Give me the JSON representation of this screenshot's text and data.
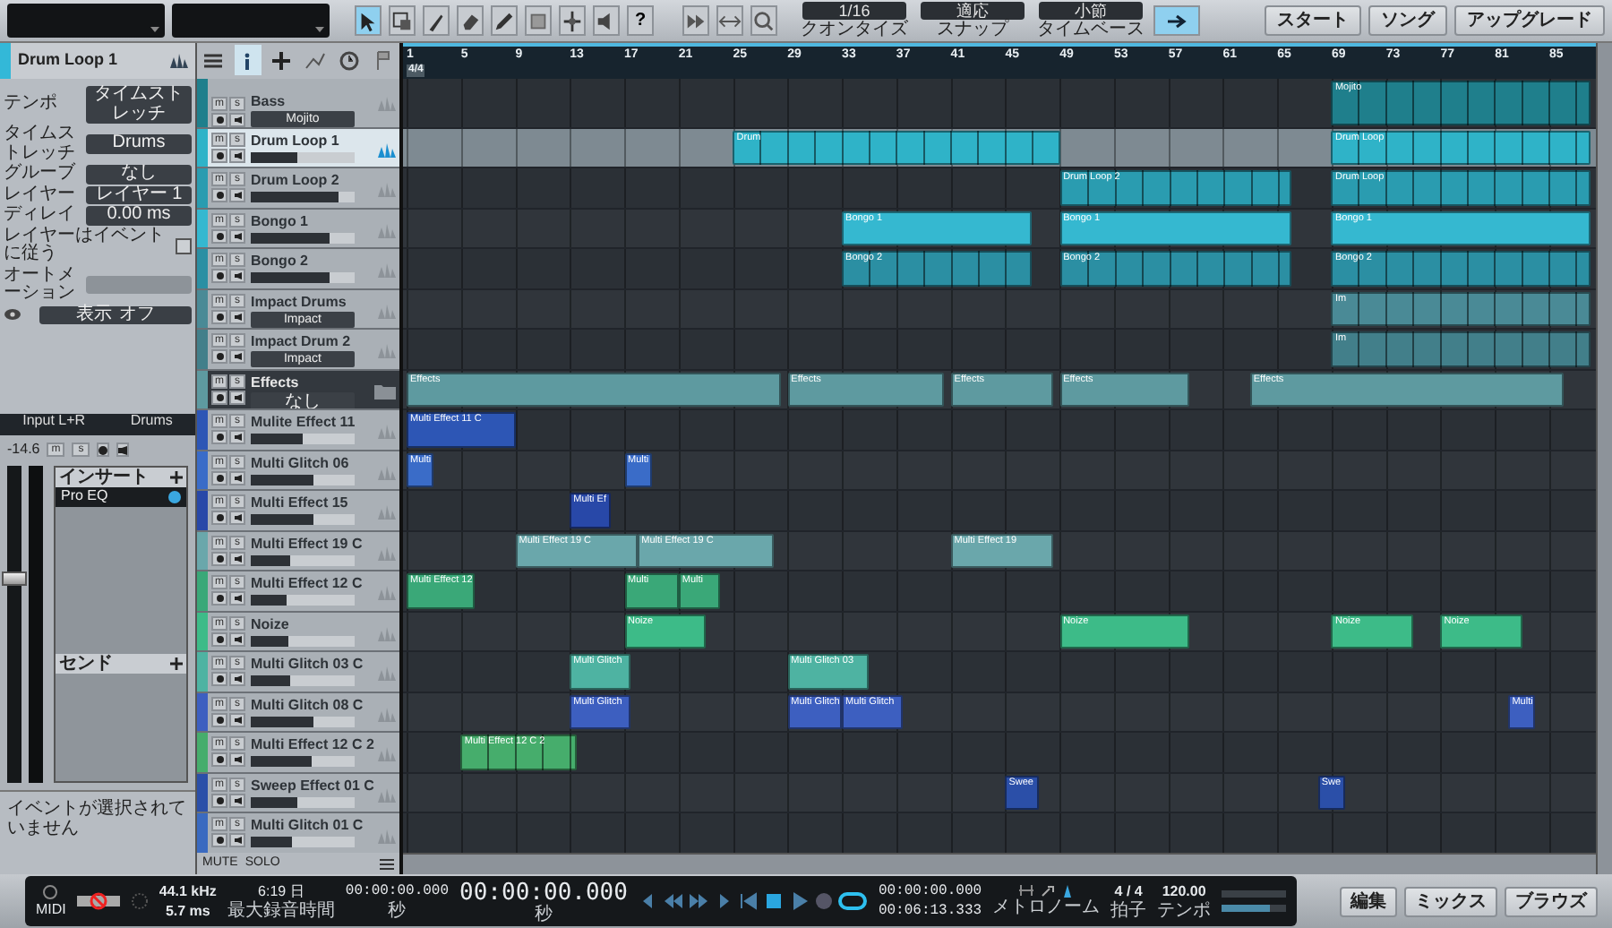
{
  "tools": [
    {
      "kind": "arrow",
      "selected": true
    },
    {
      "kind": "range",
      "selected": false
    },
    {
      "kind": "split",
      "selected": false
    },
    {
      "kind": "eraser",
      "selected": false
    },
    {
      "kind": "paint",
      "selected": false
    },
    {
      "kind": "mute",
      "selected": false
    },
    {
      "kind": "bend",
      "selected": false
    },
    {
      "kind": "listen",
      "selected": false
    }
  ],
  "help_label": "?",
  "quantize": [
    {
      "value": "1/16",
      "label": "クオンタイズ"
    },
    {
      "value": "適応",
      "label": "スナップ"
    },
    {
      "value": "小節",
      "label": "タイムベース"
    }
  ],
  "follow": {
    "on": true
  },
  "nav_buttons": [
    "スタート",
    "ソング",
    "アップグレード"
  ],
  "inspector": {
    "track_name": "Drum Loop 1",
    "rows": [
      {
        "kind": "field",
        "label": "テンポ",
        "value": "タイムストレッチ"
      },
      {
        "kind": "field",
        "label": "タイムストレッチ",
        "value": "Drums"
      },
      {
        "kind": "field",
        "label": "グルーブ",
        "value": "なし"
      },
      {
        "kind": "field",
        "label": "レイヤー",
        "value": "レイヤー 1"
      },
      {
        "kind": "field",
        "label": "ディレイ",
        "value": "0.00 ms"
      },
      {
        "kind": "check",
        "label": "レイヤーはイベントに従う",
        "checked": false
      },
      {
        "kind": "blank",
        "label": "オートメーション"
      },
      {
        "kind": "toggle",
        "label": "表示",
        "value": "オフ"
      }
    ]
  },
  "channel": {
    "input": "Input L+R",
    "output": "Drums",
    "volume": "-14.6",
    "buttons": [
      "m",
      "s"
    ],
    "level": 0.62,
    "insert_title": "インサート",
    "inserts": [
      "Pro EQ"
    ],
    "send_title": "センド"
  },
  "event_info": "イベントが選択されていません",
  "ruler": {
    "time_signature": "4/4",
    "bars": [
      "1",
      "5",
      "9",
      "13",
      "17",
      "21",
      "25",
      "29",
      "33",
      "37",
      "41",
      "45",
      "49",
      "53",
      "57",
      "61",
      "65",
      "69",
      "73",
      "77",
      "81",
      "85"
    ]
  },
  "tracks": [
    {
      "name": "Bass",
      "kind": "instrument",
      "color": "#1f7f8c",
      "selected": false,
      "buttons": [
        "m",
        "s"
      ],
      "preset": "Mojito",
      "clips": [
        {
          "label": "Mojito",
          "kind": "loop"
        }
      ]
    },
    {
      "name": "Drum Loop 1",
      "kind": "audio",
      "color": "#2fb3c8",
      "selected": true,
      "buttons": [
        "m",
        "s"
      ],
      "level": 0.45,
      "clips": [
        {
          "label": "Drum",
          "kind": "loop"
        },
        {
          "label": "Drum Loop",
          "kind": "loop"
        }
      ]
    },
    {
      "name": "Drum Loop 2",
      "kind": "audio",
      "color": "#2a9cb0",
      "selected": false,
      "buttons": [
        "m",
        "s"
      ],
      "level": 0.85,
      "clips": [
        {
          "label": "Drum Loop 2",
          "kind": "loop"
        },
        {
          "label": "Drum Loop",
          "kind": "loop"
        }
      ]
    },
    {
      "name": "Bongo 1",
      "kind": "audio",
      "color": "#35b8d0",
      "selected": false,
      "buttons": [
        "m",
        "s"
      ],
      "level": 0.75,
      "clips": [
        {
          "label": "Bongo 1",
          "kind": "single"
        },
        {
          "label": "Bongo 1",
          "kind": "single"
        },
        {
          "label": "Bongo 1",
          "kind": "single"
        }
      ]
    },
    {
      "name": "Bongo 2",
      "kind": "audio",
      "color": "#2b8fa3",
      "selected": false,
      "buttons": [
        "m",
        "s"
      ],
      "level": 0.75,
      "clips": [
        {
          "label": "Bongo 2",
          "kind": "loop"
        },
        {
          "label": "Bongo 2",
          "kind": "loop"
        },
        {
          "label": "Bongo 2",
          "kind": "loop"
        }
      ]
    },
    {
      "name": "Impact Drums",
      "kind": "instrument",
      "color": "#4a8a96",
      "selected": false,
      "buttons": [
        "m",
        "s"
      ],
      "preset": "Impact",
      "clips": [
        {
          "label": "Im",
          "kind": "loop"
        }
      ]
    },
    {
      "name": "Impact Drum 2",
      "kind": "instrument",
      "color": "#427f8a",
      "selected": false,
      "buttons": [
        "m",
        "s"
      ],
      "preset": "Impact",
      "clips": [
        {
          "label": "Im",
          "kind": "loop"
        }
      ]
    },
    {
      "name": "Effects",
      "kind": "folder",
      "color": "#5e9aa0",
      "selected": false,
      "buttons": [
        "m",
        "s"
      ],
      "preset": "なし",
      "clips": [
        {
          "label": "Effects",
          "kind": "single"
        },
        {
          "label": "Effects",
          "kind": "single"
        },
        {
          "label": "Effects",
          "kind": "single"
        },
        {
          "label": "Effects",
          "kind": "single"
        },
        {
          "label": "Effects",
          "kind": "single"
        }
      ]
    },
    {
      "name": "Mulite Effect 11",
      "kind": "audio",
      "color": "#2d56b5",
      "selected": false,
      "buttons": [
        "m",
        "s"
      ],
      "level": 0.5,
      "clips": [
        {
          "label": "Multi Effect 11 C",
          "kind": "single"
        }
      ]
    },
    {
      "name": "Multi Glitch 06",
      "kind": "audio",
      "color": "#3a6cc8",
      "selected": false,
      "buttons": [
        "m",
        "s"
      ],
      "level": 0.6,
      "clips": [
        {
          "label": "Multi",
          "kind": "single"
        },
        {
          "label": "Multi",
          "kind": "single"
        }
      ]
    },
    {
      "name": "Multi Effect 15",
      "kind": "audio",
      "color": "#2848a8",
      "selected": false,
      "buttons": [
        "m",
        "s"
      ],
      "level": 0.6,
      "clips": [
        {
          "label": "Multi Ef",
          "kind": "single"
        }
      ]
    },
    {
      "name": "Multi Effect 19  C",
      "kind": "audio",
      "color": "#6aa7ab",
      "selected": false,
      "buttons": [
        "m",
        "s"
      ],
      "level": 0.38,
      "clips": [
        {
          "label": "Multi Effect 19  C",
          "kind": "single"
        },
        {
          "label": "Multi Effect 19  C",
          "kind": "single"
        },
        {
          "label": "Multi Effect 19",
          "kind": "single"
        }
      ]
    },
    {
      "name": "Multi Effect 12  C",
      "kind": "audio",
      "color": "#3aa878",
      "selected": false,
      "buttons": [
        "m",
        "s"
      ],
      "level": 0.35,
      "clips": [
        {
          "label": "Multi Effect 12",
          "kind": "single"
        },
        {
          "label": "Multi",
          "kind": "single"
        },
        {
          "label": "Multi",
          "kind": "single"
        }
      ]
    },
    {
      "name": "Noize",
      "kind": "audio",
      "color": "#3dbb88",
      "selected": false,
      "buttons": [
        "m",
        "s"
      ],
      "level": 0.37,
      "clips": [
        {
          "label": "Noize",
          "kind": "single"
        },
        {
          "label": "Noize",
          "kind": "single"
        },
        {
          "label": "Noize",
          "kind": "single"
        },
        {
          "label": "Noize",
          "kind": "single"
        }
      ]
    },
    {
      "name": "Multi Glitch 03  C",
      "kind": "audio",
      "color": "#4eb3a2",
      "selected": false,
      "buttons": [
        "m",
        "s"
      ],
      "level": 0.38,
      "clips": [
        {
          "label": "Multi Glitch",
          "kind": "single"
        },
        {
          "label": "Multi Glitch 03",
          "kind": "single"
        }
      ]
    },
    {
      "name": "Multi Glitch 08  C",
      "kind": "audio",
      "color": "#3d5fc0",
      "selected": false,
      "buttons": [
        "m",
        "s"
      ],
      "level": 0.6,
      "clips": [
        {
          "label": "Multi Glitch",
          "kind": "single"
        },
        {
          "label": "Multi Glitch",
          "kind": "single"
        },
        {
          "label": "Multi Glitch",
          "kind": "single"
        },
        {
          "label": "Multi",
          "kind": "single"
        }
      ]
    },
    {
      "name": "Multi Effect 12  C 2",
      "kind": "audio",
      "color": "#46ad6c",
      "selected": false,
      "buttons": [
        "m",
        "s"
      ],
      "level": 0.58,
      "clips": [
        {
          "label": "Multi Effect 12 C 2",
          "kind": "loop"
        }
      ]
    },
    {
      "name": "Sweep Effect 01  C",
      "kind": "audio",
      "color": "#2b4fa8",
      "selected": false,
      "buttons": [
        "m",
        "s"
      ],
      "level": 0.45,
      "clips": [
        {
          "label": "Swee",
          "kind": "single"
        },
        {
          "label": "Swe",
          "kind": "single"
        }
      ]
    },
    {
      "name": "Multi Glitch 01  C",
      "kind": "audio",
      "color": "#3a6ac0",
      "selected": false,
      "buttons": [
        "m",
        "s"
      ],
      "level": 0.4
    }
  ],
  "track_footer": {
    "mute": "MUTE",
    "solo": "SOLO"
  },
  "transport": {
    "midi_label": "MIDI",
    "sample_rate": "44.1 kHz",
    "latency": "5.7 ms",
    "record_time": "6:19 日",
    "record_time_label": "最大録音時間",
    "position": "00:00:00.000",
    "position_unit": "秒",
    "main_time": "00:00:00.000",
    "main_unit": "秒",
    "loop_on": true,
    "loop_start": "00:00:00.000",
    "loop_end": "00:06:13.333",
    "metronome_label": "メトロノーム",
    "signature": "4 / 4",
    "signature_label": "拍子",
    "tempo": "120.00",
    "tempo_label": "テンポ"
  },
  "pages": [
    "編集",
    "ミックス",
    "ブラウズ"
  ]
}
